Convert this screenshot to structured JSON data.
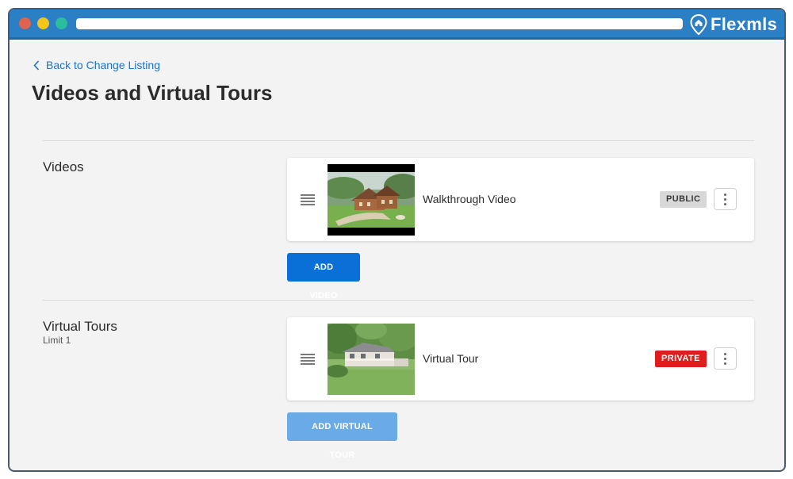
{
  "brand": {
    "name": "Flexmls"
  },
  "nav": {
    "back_label": "Back to Change Listing"
  },
  "page": {
    "title": "Videos and Virtual Tours"
  },
  "videos": {
    "title": "Videos",
    "items": [
      {
        "label": "Walkthrough Video",
        "badge": "PUBLIC"
      }
    ],
    "add_label": "ADD VIDEO"
  },
  "tours": {
    "title": "Virtual Tours",
    "limit": "Limit 1",
    "items": [
      {
        "label": "Virtual Tour",
        "badge": "PRIVATE"
      }
    ],
    "add_label": "ADD VIRTUAL TOUR"
  },
  "colors": {
    "titlebar": "#2b7fc4",
    "link": "#1a73c8",
    "primary_button": "#0a6fd6",
    "disabled_button": "#6aaae6",
    "private_badge": "#e01d1d",
    "public_badge": "#d8d8d8"
  }
}
